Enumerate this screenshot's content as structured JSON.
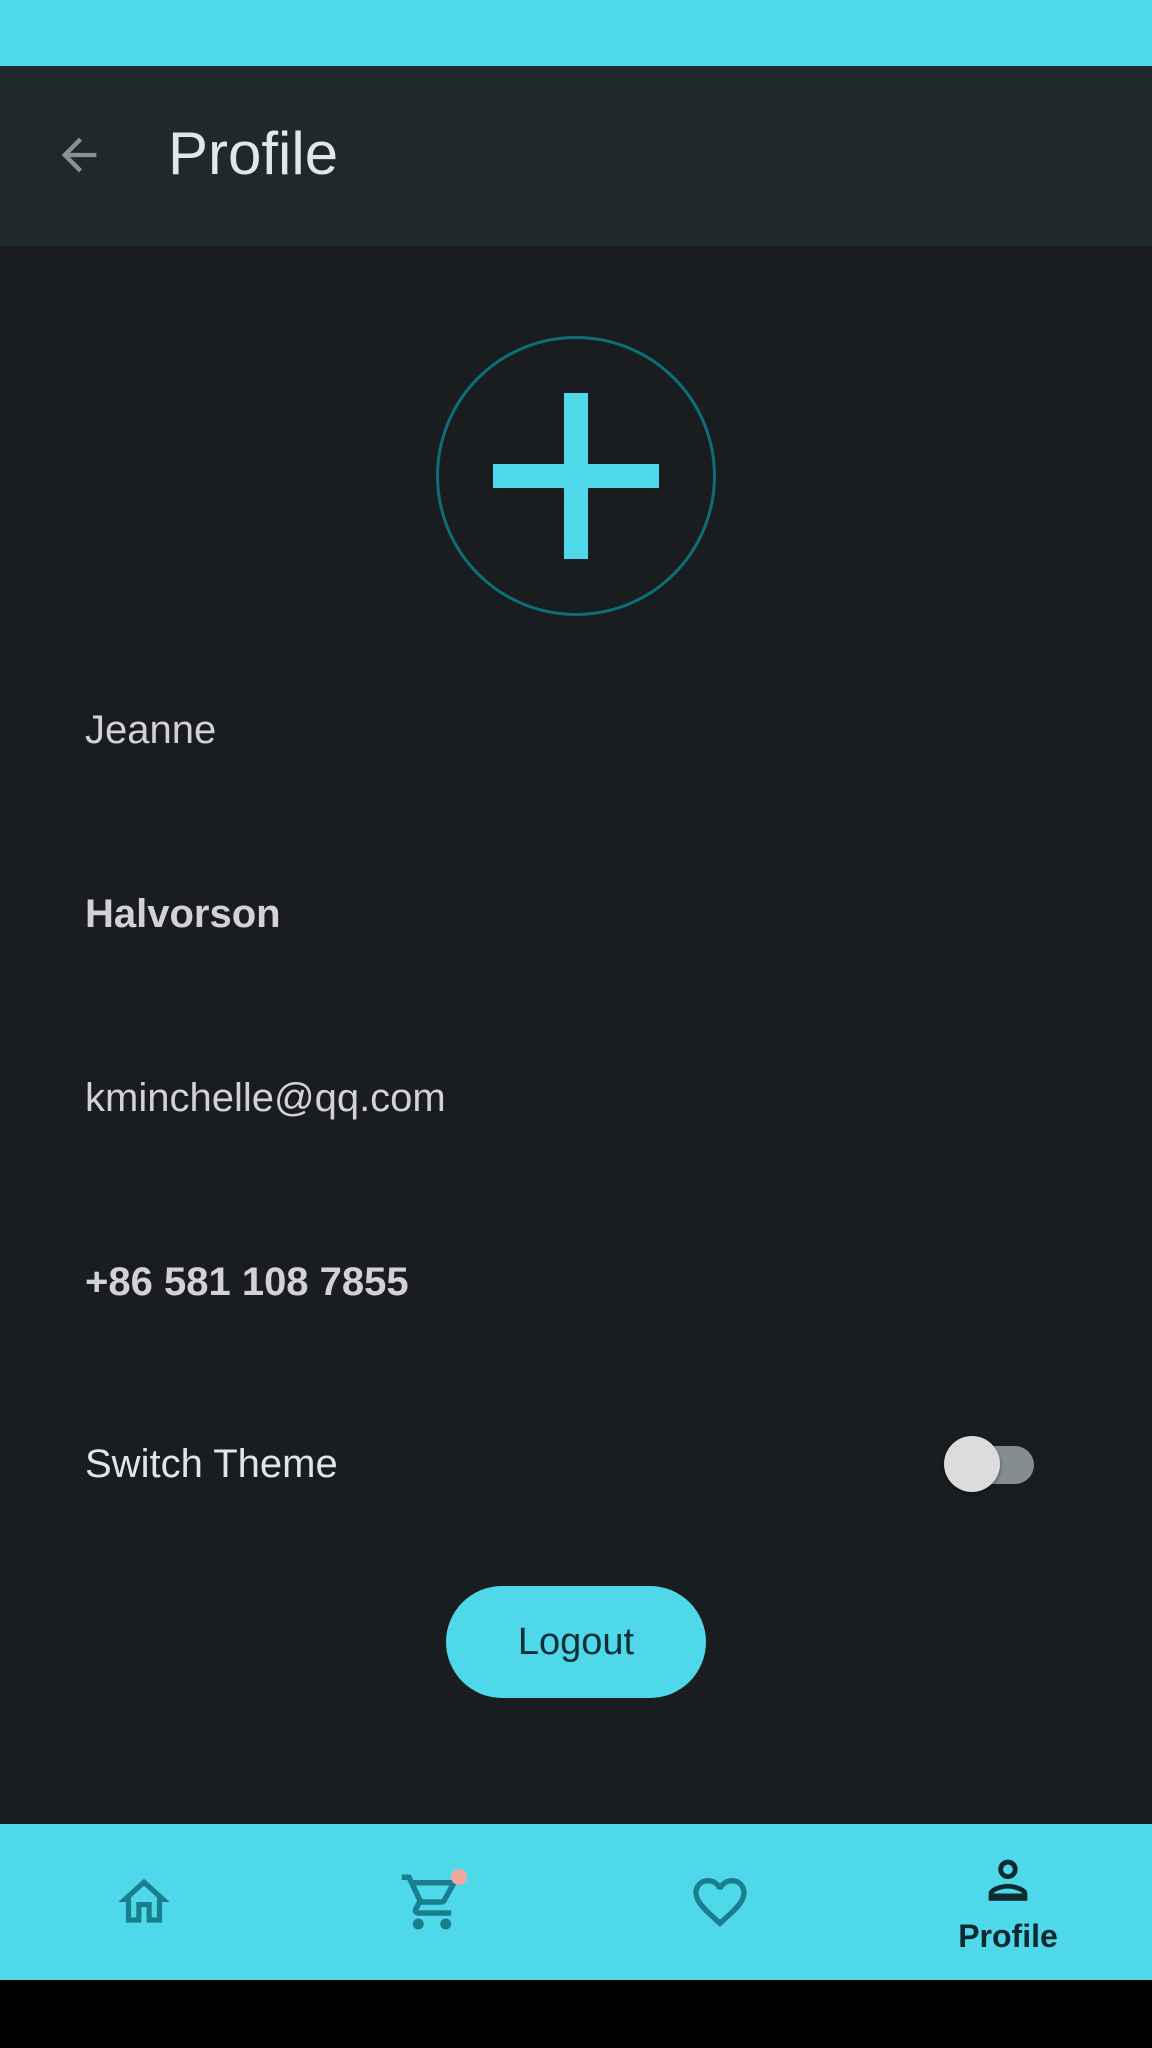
{
  "colors": {
    "accent": "#4fd8ea",
    "background": "#1a1d1f",
    "app_bar": "#1e292c",
    "avatar_border": "#0c6f78",
    "cart_badge": "#f4a6a0"
  },
  "app_bar": {
    "title": "Profile",
    "back_icon": "arrow-left-icon"
  },
  "avatar": {
    "icon": "plus-icon"
  },
  "profile": {
    "first_name": "Jeanne",
    "last_name": "Halvorson",
    "email": "kminchelle@qq.com",
    "phone": "+86 581 108 7855"
  },
  "settings": {
    "theme_label": "Switch Theme",
    "theme_toggle_on": false
  },
  "logout": {
    "label": "Logout"
  },
  "bottom_nav": {
    "items": [
      {
        "icon": "home-icon",
        "label": "",
        "active": false
      },
      {
        "icon": "cart-icon",
        "label": "",
        "active": false,
        "badge": true
      },
      {
        "icon": "heart-icon",
        "label": "",
        "active": false
      },
      {
        "icon": "person-icon",
        "label": "Profile",
        "active": true
      }
    ]
  }
}
